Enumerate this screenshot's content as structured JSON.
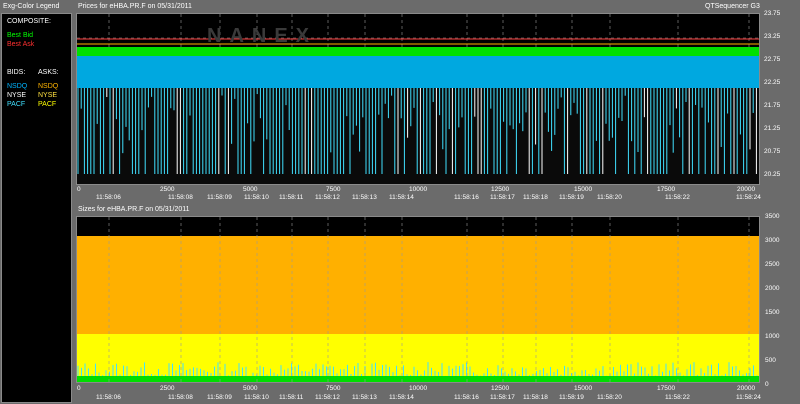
{
  "legend": {
    "title": "Exg-Color Legend",
    "composite_label": "COMPOSITE:",
    "best_bid": "Best Bid",
    "best_ask": "Best Ask",
    "bids_label": "BIDS:",
    "asks_label": "ASKS:",
    "bid_exchanges": [
      "NSDQ",
      "NYSE",
      "PACF"
    ],
    "ask_exchanges": [
      "NSDQ",
      "NYSE",
      "PACF"
    ],
    "colors": {
      "best_bid": "#00ff00",
      "best_ask": "#ff3030",
      "bid_nsdq": "#00b4ff",
      "bid_nyse": "#ffffff",
      "bid_pacf": "#40e0ff",
      "ask_nsdq": "#ffb400",
      "ask_nyse": "#ffe040",
      "ask_pacf": "#ffff00"
    }
  },
  "top_panel": {
    "title": "Prices for  eHBA.PR.F  on  05/31/2011",
    "watermark": "NANEX",
    "app_title": "QTSequencer G3",
    "y_ticks": [
      "23.75",
      "23.25",
      "22.75",
      "22.25",
      "21.75",
      "21.25",
      "20.75",
      "20.25"
    ],
    "x_ticks": [
      "0",
      "2500",
      "5000",
      "7500",
      "10000",
      "12500",
      "15000",
      "17500",
      "20000"
    ],
    "time_ticks": [
      "11:58:06",
      "11:58:08",
      "11:58:09",
      "11:58:10",
      "11:58:11",
      "11:58:12",
      "11:58:13",
      "11:58:14",
      "11:58:16",
      "11:58:17",
      "11:58:18",
      "11:58:19",
      "11:58:20",
      "11:58:22",
      "11:58:24"
    ]
  },
  "bottom_panel": {
    "title": "Sizes for  eHBA.PR.F  on  05/31/2011",
    "y_ticks": [
      "3500",
      "3000",
      "2500",
      "2000",
      "1500",
      "1000",
      "500",
      "0"
    ],
    "x_ticks": [
      "0",
      "2500",
      "5000",
      "7500",
      "10000",
      "12500",
      "15000",
      "17500",
      "20000"
    ],
    "time_ticks": [
      "11:58:06",
      "11:58:08",
      "11:58:09",
      "11:58:10",
      "11:58:11",
      "11:58:12",
      "11:58:13",
      "11:58:14",
      "11:58:16",
      "11:58:17",
      "11:58:18",
      "11:58:19",
      "11:58:20",
      "11:58:22",
      "11:58:24"
    ]
  }
}
